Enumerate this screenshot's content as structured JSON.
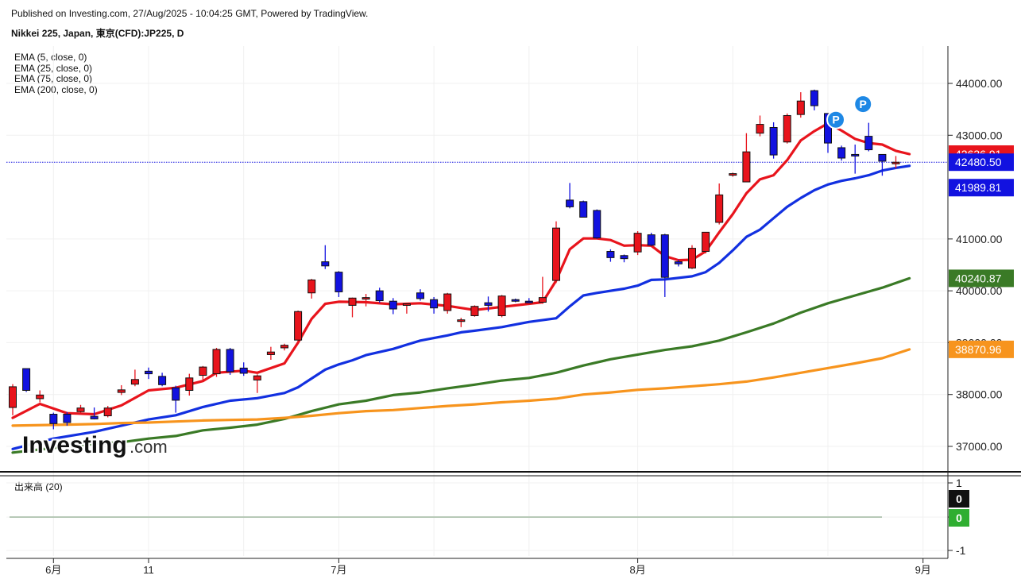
{
  "header": {
    "published": "Published on Investing.com, 27/Aug/2025 - 10:04:25 GMT, Powered by TradingView.",
    "instrument": "Nikkei 225, Japan, 東京(CFD):JP225, D"
  },
  "legend": [
    "EMA (5, close, 0)",
    "EMA (25, close, 0)",
    "EMA (75, close, 0)",
    "EMA (200, close, 0)"
  ],
  "volume_label": "出来高 (20)",
  "logo": {
    "brand": "Investing",
    "suffix": ".com"
  },
  "colors": {
    "up": "#e8141c",
    "down": "#1212e0",
    "ema5": "#e8141c",
    "ema25": "#1230e0",
    "ema75": "#3a7a26",
    "ema200": "#f7941d",
    "last_price_line": "#1212e0"
  },
  "chart_data": {
    "type": "candlestick",
    "ylim": [
      36550,
      44700
    ],
    "y_ticks": [
      37000,
      38000,
      39000,
      40000,
      41000,
      43000,
      44000
    ],
    "y_tick_labels": [
      "37000.00",
      "38000.00",
      "39000.00",
      "40000.00",
      "41000.00",
      "43000.00",
      "44000.00"
    ],
    "x_ticks": [
      {
        "label": "6月",
        "index": 3
      },
      {
        "label": "11",
        "index": 10
      },
      {
        "label": "7月",
        "index": 24
      },
      {
        "label": "8月",
        "index": 46
      },
      {
        "label": "9月",
        "index": 67
      }
    ],
    "price_badges": [
      {
        "value": "42636.91",
        "color": "#e8141c",
        "ref": 42636.91
      },
      {
        "value": "42480.50",
        "color": "#1212e0",
        "ref": 42480.5
      },
      {
        "value": "41989.81",
        "color": "#1212e0",
        "ref": 41989.81
      },
      {
        "value": "40240.87",
        "color": "#3a7a26",
        "ref": 40240.87
      },
      {
        "value": "38870.96",
        "color": "#f7941d",
        "ref": 38870.96
      }
    ],
    "last_price": 42480.5,
    "candles": [
      {
        "o": 37750,
        "h": 38200,
        "l": 37600,
        "c": 38150
      },
      {
        "o": 38500,
        "h": 38500,
        "l": 38050,
        "c": 38080
      },
      {
        "o": 37920,
        "h": 38080,
        "l": 37850,
        "c": 37990
      },
      {
        "o": 37620,
        "h": 37650,
        "l": 37330,
        "c": 37440
      },
      {
        "o": 37620,
        "h": 37660,
        "l": 37400,
        "c": 37460
      },
      {
        "o": 37670,
        "h": 37800,
        "l": 37640,
        "c": 37740
      },
      {
        "o": 37580,
        "h": 37750,
        "l": 37520,
        "c": 37530
      },
      {
        "o": 37590,
        "h": 37780,
        "l": 37560,
        "c": 37740
      },
      {
        "o": 38040,
        "h": 38180,
        "l": 37990,
        "c": 38090
      },
      {
        "o": 38200,
        "h": 38480,
        "l": 38160,
        "c": 38290
      },
      {
        "o": 38450,
        "h": 38520,
        "l": 38300,
        "c": 38400
      },
      {
        "o": 38350,
        "h": 38420,
        "l": 38160,
        "c": 38190
      },
      {
        "o": 38130,
        "h": 38170,
        "l": 37650,
        "c": 37890
      },
      {
        "o": 38080,
        "h": 38400,
        "l": 37980,
        "c": 38320
      },
      {
        "o": 38370,
        "h": 38550,
        "l": 38260,
        "c": 38530
      },
      {
        "o": 38400,
        "h": 38900,
        "l": 38340,
        "c": 38870
      },
      {
        "o": 38870,
        "h": 38900,
        "l": 38380,
        "c": 38440
      },
      {
        "o": 38510,
        "h": 38620,
        "l": 38360,
        "c": 38410
      },
      {
        "o": 38280,
        "h": 38390,
        "l": 38030,
        "c": 38360
      },
      {
        "o": 38770,
        "h": 38920,
        "l": 38670,
        "c": 38820
      },
      {
        "o": 38900,
        "h": 38980,
        "l": 38850,
        "c": 38950
      },
      {
        "o": 39050,
        "h": 39620,
        "l": 39020,
        "c": 39600
      },
      {
        "o": 39960,
        "h": 40230,
        "l": 39850,
        "c": 40210
      },
      {
        "o": 40560,
        "h": 40880,
        "l": 40420,
        "c": 40480
      },
      {
        "o": 40360,
        "h": 40380,
        "l": 39880,
        "c": 39980
      },
      {
        "o": 39720,
        "h": 39870,
        "l": 39490,
        "c": 39860
      },
      {
        "o": 39850,
        "h": 39940,
        "l": 39700,
        "c": 39870
      },
      {
        "o": 40000,
        "h": 40060,
        "l": 39770,
        "c": 39810
      },
      {
        "o": 39800,
        "h": 39860,
        "l": 39550,
        "c": 39650
      },
      {
        "o": 39720,
        "h": 39760,
        "l": 39560,
        "c": 39750
      },
      {
        "o": 39960,
        "h": 40030,
        "l": 39810,
        "c": 39850
      },
      {
        "o": 39830,
        "h": 39880,
        "l": 39560,
        "c": 39670
      },
      {
        "o": 39620,
        "h": 39960,
        "l": 39560,
        "c": 39940
      },
      {
        "o": 39420,
        "h": 39480,
        "l": 39300,
        "c": 39440
      },
      {
        "o": 39520,
        "h": 39720,
        "l": 39500,
        "c": 39700
      },
      {
        "o": 39770,
        "h": 39890,
        "l": 39600,
        "c": 39720
      },
      {
        "o": 39520,
        "h": 39920,
        "l": 39490,
        "c": 39900
      },
      {
        "o": 39830,
        "h": 39850,
        "l": 39780,
        "c": 39820
      },
      {
        "o": 39800,
        "h": 39860,
        "l": 39760,
        "c": 39790
      },
      {
        "o": 39780,
        "h": 40270,
        "l": 39750,
        "c": 39870
      },
      {
        "o": 40200,
        "h": 41340,
        "l": 40150,
        "c": 41210
      },
      {
        "o": 41750,
        "h": 42080,
        "l": 41590,
        "c": 41620
      },
      {
        "o": 41720,
        "h": 41740,
        "l": 41440,
        "c": 41420
      },
      {
        "o": 41550,
        "h": 41570,
        "l": 41000,
        "c": 41020
      },
      {
        "o": 40760,
        "h": 40800,
        "l": 40560,
        "c": 40640
      },
      {
        "o": 40680,
        "h": 40700,
        "l": 40550,
        "c": 40620
      },
      {
        "o": 40750,
        "h": 41150,
        "l": 40690,
        "c": 41110
      },
      {
        "o": 41080,
        "h": 41120,
        "l": 40860,
        "c": 40880
      },
      {
        "o": 41080,
        "h": 41100,
        "l": 39880,
        "c": 40260
      },
      {
        "o": 40560,
        "h": 40600,
        "l": 40470,
        "c": 40520
      },
      {
        "o": 40440,
        "h": 40880,
        "l": 40420,
        "c": 40820
      },
      {
        "o": 40760,
        "h": 41120,
        "l": 40720,
        "c": 41130
      },
      {
        "o": 41320,
        "h": 42070,
        "l": 41280,
        "c": 41850
      },
      {
        "o": 42240,
        "h": 42280,
        "l": 42200,
        "c": 42260
      },
      {
        "o": 42100,
        "h": 43040,
        "l": 42100,
        "c": 42680
      },
      {
        "o": 43040,
        "h": 43380,
        "l": 42980,
        "c": 43210
      },
      {
        "o": 43150,
        "h": 43250,
        "l": 42550,
        "c": 42620
      },
      {
        "o": 42870,
        "h": 43420,
        "l": 42840,
        "c": 43380
      },
      {
        "o": 43400,
        "h": 43830,
        "l": 43340,
        "c": 43660
      },
      {
        "o": 43860,
        "h": 43880,
        "l": 43480,
        "c": 43570
      },
      {
        "o": 43420,
        "h": 43420,
        "l": 42660,
        "c": 42850
      },
      {
        "o": 42760,
        "h": 42800,
        "l": 42510,
        "c": 42560
      },
      {
        "o": 42630,
        "h": 42820,
        "l": 42260,
        "c": 42620
      },
      {
        "o": 42980,
        "h": 43240,
        "l": 42690,
        "c": 42720
      },
      {
        "o": 42630,
        "h": 42630,
        "l": 42220,
        "c": 42500
      },
      {
        "o": 42460,
        "h": 42600,
        "l": 42360,
        "c": 42480
      }
    ],
    "series": [
      {
        "name": "EMA (5, close, 0)",
        "color": "#e8141c",
        "points": [
          [
            0,
            37550
          ],
          [
            2,
            37820
          ],
          [
            4,
            37640
          ],
          [
            6,
            37620
          ],
          [
            8,
            37790
          ],
          [
            10,
            38080
          ],
          [
            12,
            38130
          ],
          [
            14,
            38260
          ],
          [
            15,
            38420
          ],
          [
            17,
            38460
          ],
          [
            18,
            38420
          ],
          [
            20,
            38600
          ],
          [
            21,
            39000
          ],
          [
            22,
            39460
          ],
          [
            23,
            39750
          ],
          [
            24,
            39790
          ],
          [
            26,
            39780
          ],
          [
            28,
            39740
          ],
          [
            30,
            39760
          ],
          [
            32,
            39710
          ],
          [
            34,
            39630
          ],
          [
            36,
            39690
          ],
          [
            38,
            39750
          ],
          [
            39,
            39780
          ],
          [
            40,
            40200
          ],
          [
            41,
            40800
          ],
          [
            42,
            41010
          ],
          [
            43,
            41010
          ],
          [
            44,
            40980
          ],
          [
            45,
            40870
          ],
          [
            46,
            40880
          ],
          [
            47,
            40870
          ],
          [
            48,
            40670
          ],
          [
            49,
            40590
          ],
          [
            50,
            40600
          ],
          [
            51,
            40760
          ],
          [
            52,
            41130
          ],
          [
            53,
            41480
          ],
          [
            54,
            41880
          ],
          [
            55,
            42150
          ],
          [
            56,
            42230
          ],
          [
            57,
            42520
          ],
          [
            58,
            42900
          ],
          [
            59,
            43080
          ],
          [
            60,
            43230
          ],
          [
            61,
            43090
          ],
          [
            62,
            42930
          ],
          [
            63,
            42850
          ],
          [
            64,
            42820
          ],
          [
            65,
            42700
          ],
          [
            66,
            42637
          ]
        ]
      },
      {
        "name": "EMA (25, close, 0)",
        "color": "#1230e0",
        "points": [
          [
            0,
            36950
          ],
          [
            3,
            37150
          ],
          [
            6,
            37280
          ],
          [
            8,
            37400
          ],
          [
            10,
            37520
          ],
          [
            12,
            37600
          ],
          [
            14,
            37760
          ],
          [
            16,
            37880
          ],
          [
            18,
            37930
          ],
          [
            20,
            38030
          ],
          [
            21,
            38140
          ],
          [
            22,
            38310
          ],
          [
            23,
            38480
          ],
          [
            24,
            38580
          ],
          [
            25,
            38660
          ],
          [
            26,
            38760
          ],
          [
            28,
            38880
          ],
          [
            29,
            38960
          ],
          [
            30,
            39040
          ],
          [
            32,
            39140
          ],
          [
            33,
            39200
          ],
          [
            34,
            39230
          ],
          [
            36,
            39300
          ],
          [
            38,
            39400
          ],
          [
            40,
            39470
          ],
          [
            41,
            39700
          ],
          [
            42,
            39910
          ],
          [
            43,
            39960
          ],
          [
            45,
            40040
          ],
          [
            46,
            40100
          ],
          [
            47,
            40210
          ],
          [
            48,
            40220
          ],
          [
            50,
            40280
          ],
          [
            51,
            40360
          ],
          [
            52,
            40540
          ],
          [
            53,
            40780
          ],
          [
            54,
            41040
          ],
          [
            55,
            41180
          ],
          [
            56,
            41400
          ],
          [
            57,
            41620
          ],
          [
            58,
            41790
          ],
          [
            59,
            41940
          ],
          [
            60,
            42050
          ],
          [
            61,
            42120
          ],
          [
            62,
            42170
          ],
          [
            63,
            42230
          ],
          [
            64,
            42320
          ],
          [
            65,
            42370
          ],
          [
            66,
            42410
          ]
        ]
      },
      {
        "name": "EMA (75, close, 0)",
        "color": "#3a7a26",
        "points": [
          [
            0,
            36880
          ],
          [
            4,
            37000
          ],
          [
            6,
            37050
          ],
          [
            8,
            37080
          ],
          [
            10,
            37150
          ],
          [
            12,
            37200
          ],
          [
            14,
            37310
          ],
          [
            16,
            37360
          ],
          [
            18,
            37420
          ],
          [
            20,
            37530
          ],
          [
            22,
            37680
          ],
          [
            24,
            37810
          ],
          [
            26,
            37880
          ],
          [
            28,
            37990
          ],
          [
            30,
            38040
          ],
          [
            32,
            38120
          ],
          [
            34,
            38190
          ],
          [
            36,
            38270
          ],
          [
            38,
            38320
          ],
          [
            40,
            38420
          ],
          [
            42,
            38560
          ],
          [
            44,
            38680
          ],
          [
            46,
            38770
          ],
          [
            48,
            38860
          ],
          [
            50,
            38930
          ],
          [
            52,
            39040
          ],
          [
            54,
            39200
          ],
          [
            56,
            39370
          ],
          [
            58,
            39580
          ],
          [
            60,
            39760
          ],
          [
            62,
            39910
          ],
          [
            64,
            40060
          ],
          [
            66,
            40241
          ]
        ]
      },
      {
        "name": "EMA (200, close, 0)",
        "color": "#f7941d",
        "points": [
          [
            0,
            37400
          ],
          [
            4,
            37420
          ],
          [
            6,
            37430
          ],
          [
            8,
            37450
          ],
          [
            10,
            37460
          ],
          [
            12,
            37480
          ],
          [
            14,
            37500
          ],
          [
            16,
            37510
          ],
          [
            18,
            37520
          ],
          [
            20,
            37550
          ],
          [
            22,
            37590
          ],
          [
            24,
            37640
          ],
          [
            26,
            37680
          ],
          [
            28,
            37700
          ],
          [
            30,
            37740
          ],
          [
            32,
            37780
          ],
          [
            34,
            37810
          ],
          [
            36,
            37850
          ],
          [
            38,
            37880
          ],
          [
            40,
            37920
          ],
          [
            42,
            38000
          ],
          [
            44,
            38040
          ],
          [
            46,
            38090
          ],
          [
            48,
            38120
          ],
          [
            50,
            38160
          ],
          [
            52,
            38200
          ],
          [
            54,
            38250
          ],
          [
            56,
            38330
          ],
          [
            58,
            38420
          ],
          [
            60,
            38510
          ],
          [
            62,
            38600
          ],
          [
            64,
            38700
          ],
          [
            66,
            38871
          ]
        ]
      }
    ],
    "volume": {
      "label": "出来高 (20)",
      "y_ticks": [
        "1",
        "0",
        "-1"
      ],
      "badges": [
        {
          "value": "0",
          "color": "#111111"
        },
        {
          "value": "0",
          "color": "#2fae31"
        }
      ]
    },
    "markers": [
      {
        "index": 60,
        "price": 43300,
        "text": "P"
      },
      {
        "index": 62,
        "price": 43600,
        "text": "P"
      }
    ]
  }
}
